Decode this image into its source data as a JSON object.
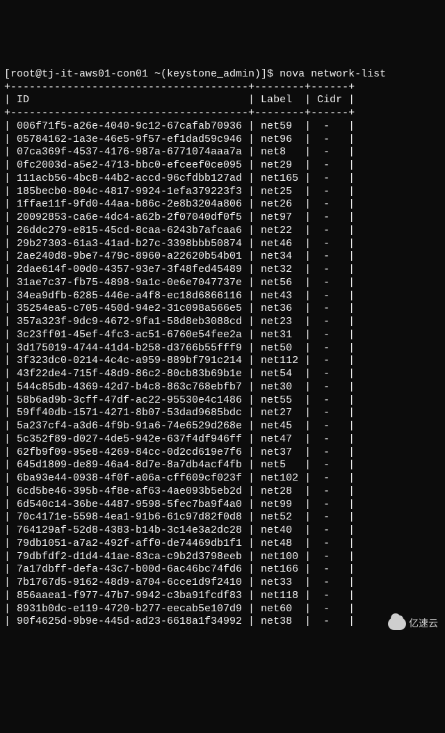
{
  "prompt": {
    "user_host": "[root@tj-it-aws01-con01 ~(keystone_admin)]$ ",
    "command": "nova network-list"
  },
  "table": {
    "border_top": "+--------------------------------------+--------+------+",
    "header": {
      "id": "ID",
      "label": "Label",
      "cidr": "Cidr"
    },
    "rows": [
      {
        "id": "006f71f5-a26e-4040-9c12-67cafab70936",
        "label": "net59",
        "cidr": "-"
      },
      {
        "id": "05784162-1a3e-46e5-9f57-ef1dad59c946",
        "label": "net96",
        "cidr": "-"
      },
      {
        "id": "07ca369f-4537-4176-987a-6771074aaa7a",
        "label": "net8",
        "cidr": "-"
      },
      {
        "id": "0fc2003d-a5e2-4713-bbc0-efceef0ce095",
        "label": "net29",
        "cidr": "-"
      },
      {
        "id": "111acb56-4bc8-44b2-accd-96cfdbb127ad",
        "label": "net165",
        "cidr": "-"
      },
      {
        "id": "185becb0-804c-4817-9924-1efa379223f3",
        "label": "net25",
        "cidr": "-"
      },
      {
        "id": "1ffae11f-9fd0-44aa-b86c-2e8b3204a806",
        "label": "net26",
        "cidr": "-"
      },
      {
        "id": "20092853-ca6e-4dc4-a62b-2f07040df0f5",
        "label": "net97",
        "cidr": "-"
      },
      {
        "id": "26ddc279-e815-45cd-8caa-6243b7afcaa6",
        "label": "net22",
        "cidr": "-"
      },
      {
        "id": "29b27303-61a3-41ad-b27c-3398bbb50874",
        "label": "net46",
        "cidr": "-"
      },
      {
        "id": "2ae240d8-9be7-479c-8960-a22620b54b01",
        "label": "net34",
        "cidr": "-"
      },
      {
        "id": "2dae614f-00d0-4357-93e7-3f48fed45489",
        "label": "net32",
        "cidr": "-"
      },
      {
        "id": "31ae7c37-fb75-4898-9a1c-0e6e7047737e",
        "label": "net56",
        "cidr": "-"
      },
      {
        "id": "34ea9dfb-6285-446e-a4f8-ec18d6866116",
        "label": "net43",
        "cidr": "-"
      },
      {
        "id": "35254ea5-c705-450d-94e2-31c098a566e5",
        "label": "net36",
        "cidr": "-"
      },
      {
        "id": "357a323f-9dc9-4672-9fa1-58d8eb3088cd",
        "label": "net23",
        "cidr": "-"
      },
      {
        "id": "3c23ff01-45ef-4fc3-ac51-6760e54fee2a",
        "label": "net31",
        "cidr": "-"
      },
      {
        "id": "3d175019-4744-41d4-b258-d3766b55fff9",
        "label": "net50",
        "cidr": "-"
      },
      {
        "id": "3f323dc0-0214-4c4c-a959-889bf791c214",
        "label": "net112",
        "cidr": "-"
      },
      {
        "id": "43f22de4-715f-48d9-86c2-80cb83b69b1e",
        "label": "net54",
        "cidr": "-"
      },
      {
        "id": "544c85db-4369-42d7-b4c8-863c768ebfb7",
        "label": "net30",
        "cidr": "-"
      },
      {
        "id": "58b6ad9b-3cff-47df-ac22-95530e4c1486",
        "label": "net55",
        "cidr": "-"
      },
      {
        "id": "59ff40db-1571-4271-8b07-53dad9685bdc",
        "label": "net27",
        "cidr": "-"
      },
      {
        "id": "5a237cf4-a3d6-4f9b-91a6-74e6529d268e",
        "label": "net45",
        "cidr": "-"
      },
      {
        "id": "5c352f89-d027-4de5-942e-637f4df946ff",
        "label": "net47",
        "cidr": "-"
      },
      {
        "id": "62fb9f09-95e8-4269-84cc-0d2cd619e7f6",
        "label": "net37",
        "cidr": "-"
      },
      {
        "id": "645d1809-de89-46a4-8d7e-8a7db4acf4fb",
        "label": "net5",
        "cidr": "-"
      },
      {
        "id": "6ba93e44-0938-4f0f-a06a-cff609cf023f",
        "label": "net102",
        "cidr": "-"
      },
      {
        "id": "6cd5be46-395b-4f8e-af63-4ae093b5eb2d",
        "label": "net28",
        "cidr": "-"
      },
      {
        "id": "6d540c14-36be-4487-9598-5fec7ba9f4a0",
        "label": "net99",
        "cidr": "-"
      },
      {
        "id": "70c4171e-5598-4ea1-91b6-61c97d82f0d8",
        "label": "net52",
        "cidr": "-"
      },
      {
        "id": "764129af-52d8-4383-b14b-3c14e3a2dc28",
        "label": "net40",
        "cidr": "-"
      },
      {
        "id": "79db1051-a7a2-492f-aff0-de74469db1f1",
        "label": "net48",
        "cidr": "-"
      },
      {
        "id": "79dbfdf2-d1d4-41ae-83ca-c9b2d3798eeb",
        "label": "net100",
        "cidr": "-"
      },
      {
        "id": "7a17dbff-defa-43c7-b00d-6ac46bc74fd6",
        "label": "net166",
        "cidr": "-"
      },
      {
        "id": "7b1767d5-9162-48d9-a704-6cce1d9f2410",
        "label": "net33",
        "cidr": "-"
      },
      {
        "id": "856aaea1-f977-47b7-9942-c3ba91fcdf83",
        "label": "net118",
        "cidr": "-"
      },
      {
        "id": "8931b0dc-e119-4720-b277-eecab5e107d9",
        "label": "net60",
        "cidr": "-"
      },
      {
        "id": "90f4625d-9b9e-445d-ad23-6618a1f34992",
        "label": "net38",
        "cidr": "-"
      }
    ]
  },
  "watermark": {
    "text": "亿速云"
  }
}
